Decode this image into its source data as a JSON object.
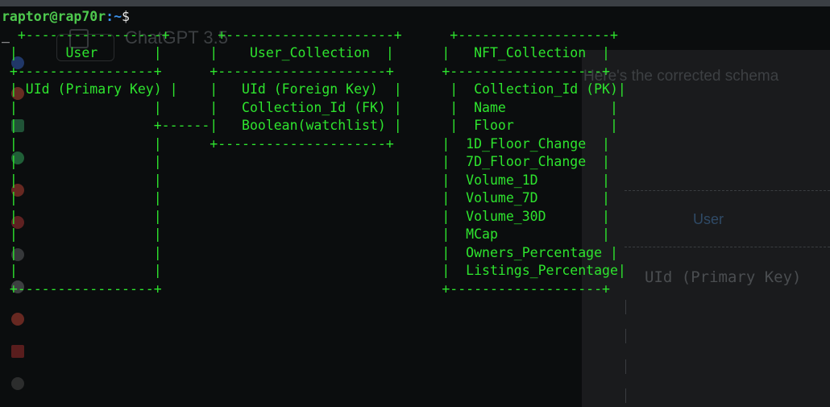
{
  "background_window": {
    "title": "ChatGPT 3.5",
    "text": "Here's the corrected schema",
    "user_label": "User",
    "uid_label": "UId (Primary Key)"
  },
  "prompt": {
    "user_host": "raptor@rap70r",
    "path": ":~",
    "symbol": "$"
  },
  "cursor": "_",
  "diagram_lines": [
    " +-----------------+      +---------------------+      +-------------------+",
    " |      User       |      |    User_Collection  |      |   NFT_Collection  |",
    " +-----------------+      +---------------------+      +-------------------+",
    " | UId (Primary Key) |    |   UId (Foreign Key)  |      |  Collection_Id (PK)|",
    " |                 |      |   Collection_Id (FK) |      |  Name             |",
    " |                 +------|   Boolean(watchlist) |      |  Floor            |",
    " |                 |      +---------------------+      |  1D_Floor_Change  |",
    " |                 |                                   |  7D_Floor_Change  |",
    " |                 |                                   |  Volume_1D        |",
    " |                 |                                   |  Volume_7D        |",
    " |                 |                                   |  Volume_30D       |",
    " |                 |                                   |  MCap             |",
    " |                 |                                   |  Owners_Percentage |",
    " |                 |                                   |  Listings_Percentage|",
    " +-----------------+                                   +-------------------+"
  ],
  "colors": {
    "terminal_green": "#2ee42e",
    "prompt_user": "#4ec94e",
    "prompt_path": "#3a8ee6",
    "background": "#0b0d0e"
  }
}
